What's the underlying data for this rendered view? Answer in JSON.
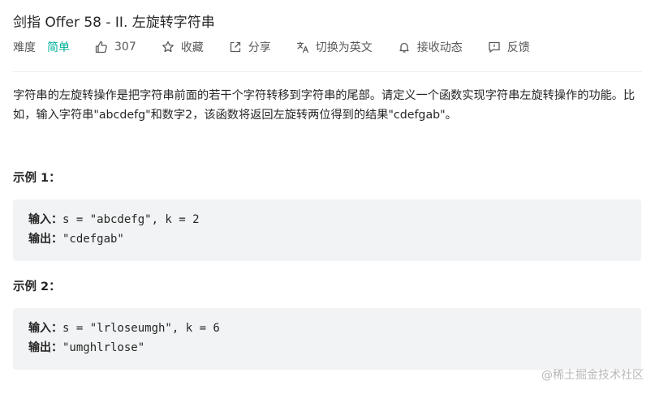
{
  "problem": {
    "title": "剑指 Offer 58 - II. 左旋转字符串"
  },
  "meta": {
    "difficulty_label": "难度",
    "difficulty_value": "简单",
    "difficulty_color": "#00af9b",
    "likes_icon": "thumbs-up-icon",
    "likes_count": "307",
    "favorite_icon": "star-icon",
    "favorite_label": "收藏",
    "share_icon": "share-icon",
    "share_label": "分享",
    "translate_icon": "translate-icon",
    "translate_label": "切换为英文",
    "notify_icon": "bell-icon",
    "notify_label": "接收动态",
    "feedback_icon": "feedback-icon",
    "feedback_label": "反馈"
  },
  "description": {
    "text": "字符串的左旋转操作是把字符串前面的若干个字符转移到字符串的尾部。请定义一个函数实现字符串左旋转操作的功能。比如，输入字符串\"abcdefg\"和数字2，该函数将返回左旋转两位得到的结果\"cdefgab\"。"
  },
  "examples": [
    {
      "title": "示例 1：",
      "input_key": "输入：",
      "input_value": "s = \"abcdefg\", k = 2",
      "output_key": "输出：",
      "output_value": "\"cdefgab\""
    },
    {
      "title": "示例 2：",
      "input_key": "输入：",
      "input_value": "s = \"lrloseumgh\", k = 6",
      "output_key": "输出：",
      "output_value": "\"umghlrlose\""
    }
  ],
  "watermark": "@稀土掘金技术社区",
  "colors": {
    "code_background": "#f2f3f4",
    "text": "#262626",
    "meta_text": "#595959"
  }
}
